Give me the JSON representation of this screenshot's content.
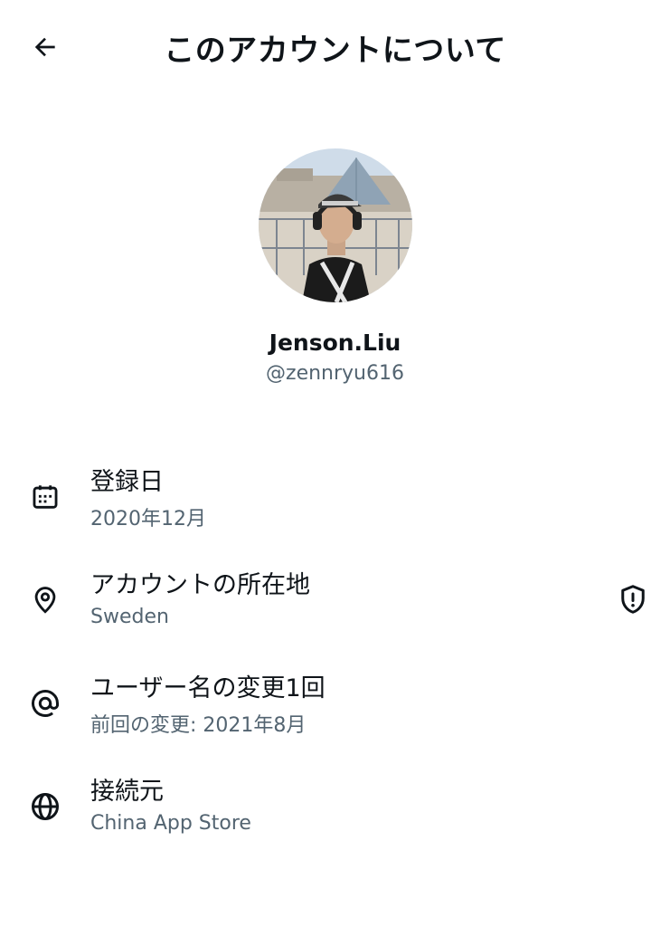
{
  "header": {
    "title": "このアカウントについて",
    "back_icon": "arrow-left-icon"
  },
  "profile": {
    "display_name": "Jenson.Liu",
    "handle": "@zennryu616"
  },
  "info": {
    "joined": {
      "label": "登録日",
      "value": "2020年12月",
      "icon": "calendar-icon"
    },
    "location": {
      "label": "アカウントの所在地",
      "value": "Sweden",
      "icon": "location-pin-icon",
      "badge_icon": "shield-alert-icon"
    },
    "username_changes": {
      "label": "ユーザー名の変更1回",
      "value": "前回の変更: 2021年8月",
      "icon": "at-sign-icon"
    },
    "connected_via": {
      "label": "接続元",
      "value": "China App Store",
      "icon": "globe-icon"
    }
  },
  "colors": {
    "text_primary": "#0f1419",
    "text_secondary": "#536471",
    "background": "#ffffff"
  }
}
